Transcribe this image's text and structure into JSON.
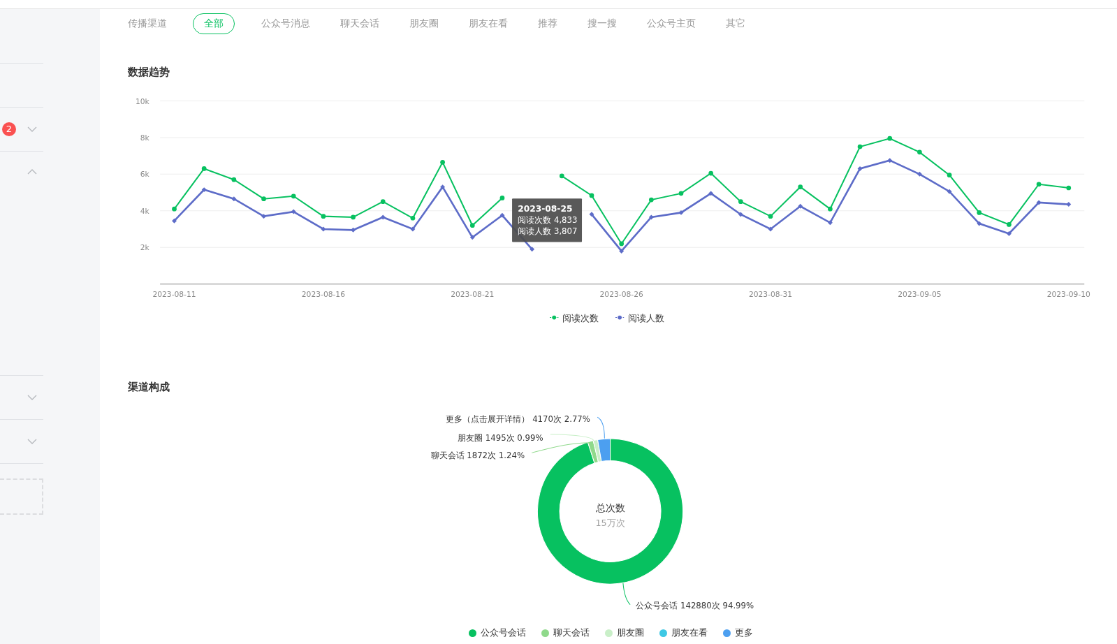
{
  "sidebar": {
    "items": [
      {
        "badge": "2",
        "expanded": false
      },
      {
        "expanded": true
      },
      {
        "expanded": false
      },
      {
        "expanded": false
      }
    ]
  },
  "channel_filter": {
    "label": "传播渠道",
    "tabs": [
      {
        "label": "全部",
        "selected": true
      },
      {
        "label": "公众号消息",
        "selected": false
      },
      {
        "label": "聊天会话",
        "selected": false
      },
      {
        "label": "朋友圈",
        "selected": false
      },
      {
        "label": "朋友在看",
        "selected": false
      },
      {
        "label": "推荐",
        "selected": false
      },
      {
        "label": "搜一搜",
        "selected": false
      },
      {
        "label": "公众号主页",
        "selected": false
      },
      {
        "label": "其它",
        "selected": false
      }
    ]
  },
  "trend": {
    "title": "数据趋势",
    "tooltip": {
      "title": "2023-08-25",
      "lines": [
        "阅读次数 4,833",
        "阅读人数 3,807"
      ]
    },
    "chart_data": {
      "type": "line",
      "categories": [
        "2023-08-11",
        null,
        null,
        null,
        null,
        "2023-08-16",
        null,
        null,
        null,
        null,
        "2023-08-21",
        null,
        null,
        null,
        null,
        "2023-08-26",
        null,
        null,
        null,
        null,
        "2023-08-31",
        null,
        null,
        null,
        null,
        "2023-09-05",
        null,
        null,
        null,
        null,
        "2023-09-10"
      ],
      "ylim": [
        0,
        10000
      ],
      "grid": true,
      "legend": "bottom",
      "yticks": [
        {
          "value": 2000,
          "label": "2k"
        },
        {
          "value": 4000,
          "label": "4k"
        },
        {
          "value": 6000,
          "label": "6k"
        },
        {
          "value": 8000,
          "label": "8k"
        },
        {
          "value": 10000,
          "label": "10k"
        }
      ],
      "series": [
        {
          "name": "阅读次数",
          "color": "#07c160",
          "marker": "circle",
          "values": [
            4100,
            6300,
            5700,
            4650,
            4800,
            3700,
            3650,
            4500,
            3600,
            6650,
            3200,
            4700,
            null,
            5900,
            4833,
            2200,
            4600,
            4950,
            6050,
            4500,
            3700,
            5300,
            4100,
            7500,
            7950,
            7200,
            5950,
            3900,
            3250,
            5450,
            5250
          ]
        },
        {
          "name": "阅读人数",
          "color": "#5d6cc8",
          "marker": "diamond",
          "values": [
            3450,
            5150,
            4650,
            3700,
            3950,
            3000,
            2950,
            3650,
            3000,
            5300,
            2550,
            3750,
            1900,
            null,
            3807,
            1800,
            3650,
            3900,
            4950,
            3800,
            3000,
            4250,
            3350,
            6300,
            6750,
            6000,
            5050,
            3300,
            2750,
            4450,
            4350
          ]
        }
      ]
    }
  },
  "composition": {
    "title": "渠道构成",
    "center_title": "总次数",
    "center_value": "15万次",
    "chart_data": {
      "type": "donut",
      "categories": [
        "公众号会话",
        "聊天会话",
        "朋友圈",
        "朋友在看",
        "更多"
      ],
      "values": [
        94.99,
        1.24,
        0.99,
        null,
        2.77
      ],
      "colors": [
        "#07c160",
        "#8fd98b",
        "#c9efc8",
        "#3ec8e4",
        "#4c9ff0"
      ],
      "value_labels": [
        "公众号会话 142880次 94.99%",
        "聊天会话 1872次 1.24%",
        "朋友圈 1495次 0.99%",
        null,
        "更多（点击展开详情） 4170次 2.77%"
      ]
    }
  }
}
